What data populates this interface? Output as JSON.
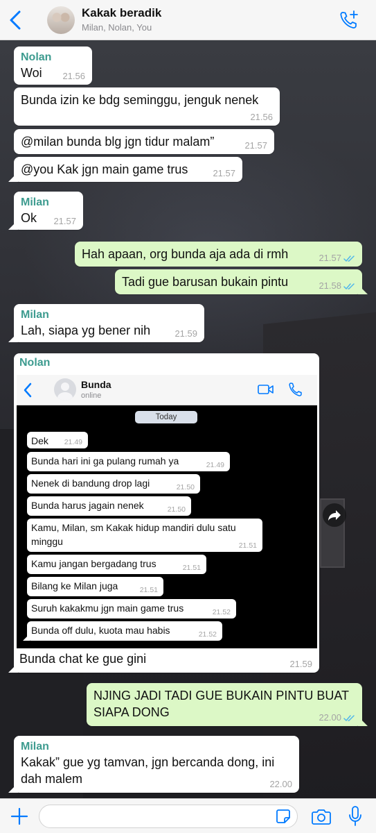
{
  "header": {
    "title": "Kakak beradik",
    "subtitle": "Milan, Nolan, You",
    "accent": "#007aff"
  },
  "messages": [
    {
      "sender": "Nolan",
      "text": "Woi",
      "time": "21.56"
    },
    {
      "text": "Bunda izin ke bdg seminggu, jenguk nenek",
      "time": "21.56"
    },
    {
      "text": "@milan bunda blg jgn tidur malam”",
      "time": "21.57"
    },
    {
      "text": "@you Kak jgn main game trus",
      "time": "21.57"
    },
    {
      "sender": "Milan",
      "text": "Ok",
      "time": "21.57"
    },
    {
      "text": "Hah apaan, org bunda aja ada di rmh",
      "time": "21.57",
      "outgoing": true,
      "read": true
    },
    {
      "text": "Tadi gue barusan bukain pintu",
      "time": "21.58",
      "outgoing": true,
      "read": true
    },
    {
      "sender": "Milan",
      "text": "Lah, siapa yg bener nih",
      "time": "21.59"
    },
    {
      "sender": "Nolan",
      "caption": "Bunda chat ke gue gini",
      "time": "21.59",
      "image": "screenshot"
    },
    {
      "text": "NJING JADI TADI GUE BUKAIN PINTU BUAT SIAPA DONG",
      "time": "22.00",
      "outgoing": true,
      "read": true
    },
    {
      "sender": "Milan",
      "text": "Kakak” gue yg tamvan, jgn bercanda dong, ini dah malem",
      "time": "22.00"
    }
  ],
  "embedded": {
    "contact": "Bunda",
    "status": "online",
    "date_badge": "Today",
    "messages": [
      {
        "text": "Dek",
        "time": "21.49"
      },
      {
        "text": "Bunda hari ini ga pulang rumah ya",
        "time": "21.49"
      },
      {
        "text": "Nenek di bandung drop lagi",
        "time": "21.50"
      },
      {
        "text": "Bunda harus jagain nenek",
        "time": "21.50"
      },
      {
        "text": "Kamu, Milan, sm Kakak hidup mandiri dulu satu minggu",
        "time": "21.51"
      },
      {
        "text": "Kamu jangan bergadang trus",
        "time": "21.51"
      },
      {
        "text": "Bilang ke Milan juga",
        "time": "21.51"
      },
      {
        "text": "Suruh kakakmu jgn main game trus",
        "time": "21.52"
      },
      {
        "text": "Bunda off dulu, kuota mau habis",
        "time": "21.52"
      }
    ]
  },
  "input": {
    "value": "",
    "placeholder": ""
  },
  "colors": {
    "incoming_bubble": "#ffffff",
    "outgoing_bubble": "#dcf8c6",
    "sender_name": "#3d9b8f",
    "read_ticks": "#4fb6ec",
    "icons": "#007aff"
  },
  "icons": [
    "back-chevron-icon",
    "add-call-icon",
    "video-call-icon",
    "phone-icon",
    "forward-icon",
    "plus-icon",
    "sticker-icon",
    "camera-icon",
    "microphone-icon",
    "read-receipt-icon"
  ]
}
